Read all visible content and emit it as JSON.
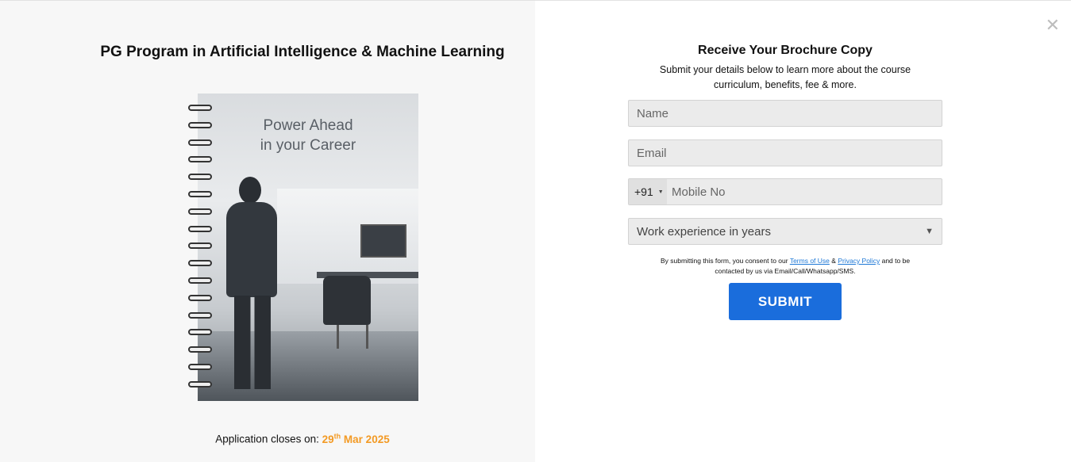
{
  "left": {
    "program_title": "PG Program in Artificial Intelligence & Machine Learning",
    "cover_title_line1": "Power Ahead",
    "cover_title_line2": "in your Career",
    "closing_label": "Application closes on:",
    "closing_day": "29",
    "closing_suffix": "th",
    "closing_month_year": "Mar 2025"
  },
  "form": {
    "title": "Receive Your Brochure Copy",
    "subtitle_line1": "Submit your details below to learn more about the course",
    "subtitle_line2": "curriculum, benefits, fee & more.",
    "name_placeholder": "Name",
    "email_placeholder": "Email",
    "country_code": "+91",
    "mobile_placeholder": "Mobile No",
    "experience_label": "Work experience in years",
    "consent_prefix": "By submitting this form, you consent to our",
    "terms_link": "Terms of Use",
    "consent_and": "&",
    "privacy_link": "Privacy Policy",
    "consent_suffix_line1": "and to be",
    "consent_line2": "contacted by us via Email/Call/Whatsapp/SMS.",
    "submit_label": "SUBMIT"
  },
  "colors": {
    "accent_orange": "#f39a24",
    "submit_blue": "#1a6ddc",
    "link_blue": "#1e78d6"
  },
  "icons": {
    "close": "close-icon",
    "dropdown": "chevron-down-icon"
  }
}
